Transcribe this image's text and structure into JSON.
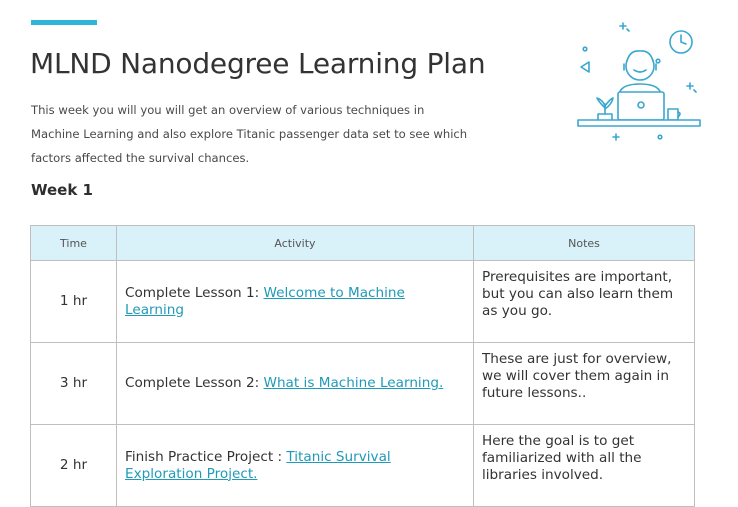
{
  "header": {
    "title": "MLND Nanodegree Learning Plan",
    "intro_line1": "This week you will you will  get an overview of  various techniques in",
    "intro_line2": "Machine Learning and also explore Titanic passenger data set to see which",
    "intro_line3": "factors affected the survival chances."
  },
  "section": {
    "week_label": "Week 1"
  },
  "table": {
    "headers": {
      "time": "Time",
      "activity": "Activity",
      "notes": "Notes"
    },
    "rows": [
      {
        "time": "1 hr",
        "activity_prefix": "Complete Lesson 1: ",
        "activity_link": "Welcome to Machine Learning",
        "notes": "Prerequisites are important, but you can also learn them as you go."
      },
      {
        "time": "3  hr",
        "activity_prefix": "Complete  Lesson 2: ",
        "activity_link": "What is Machine Learning.",
        "notes": "These are just for overview, we will cover them again in future lessons.."
      },
      {
        "time": "2 hr",
        "activity_prefix": "Finish Practice Project : ",
        "activity_link": "Titanic Survival Exploration Project.",
        "notes": "Here the goal is to get familiarized with all the libraries involved."
      }
    ]
  },
  "colors": {
    "accent": "#2fb5d8",
    "header_bg": "#d9f1f8",
    "link": "#1f9ab8",
    "illustration_stroke": "#3aa7cf"
  },
  "illustration": {
    "icon": "student-at-laptop-illustration"
  }
}
